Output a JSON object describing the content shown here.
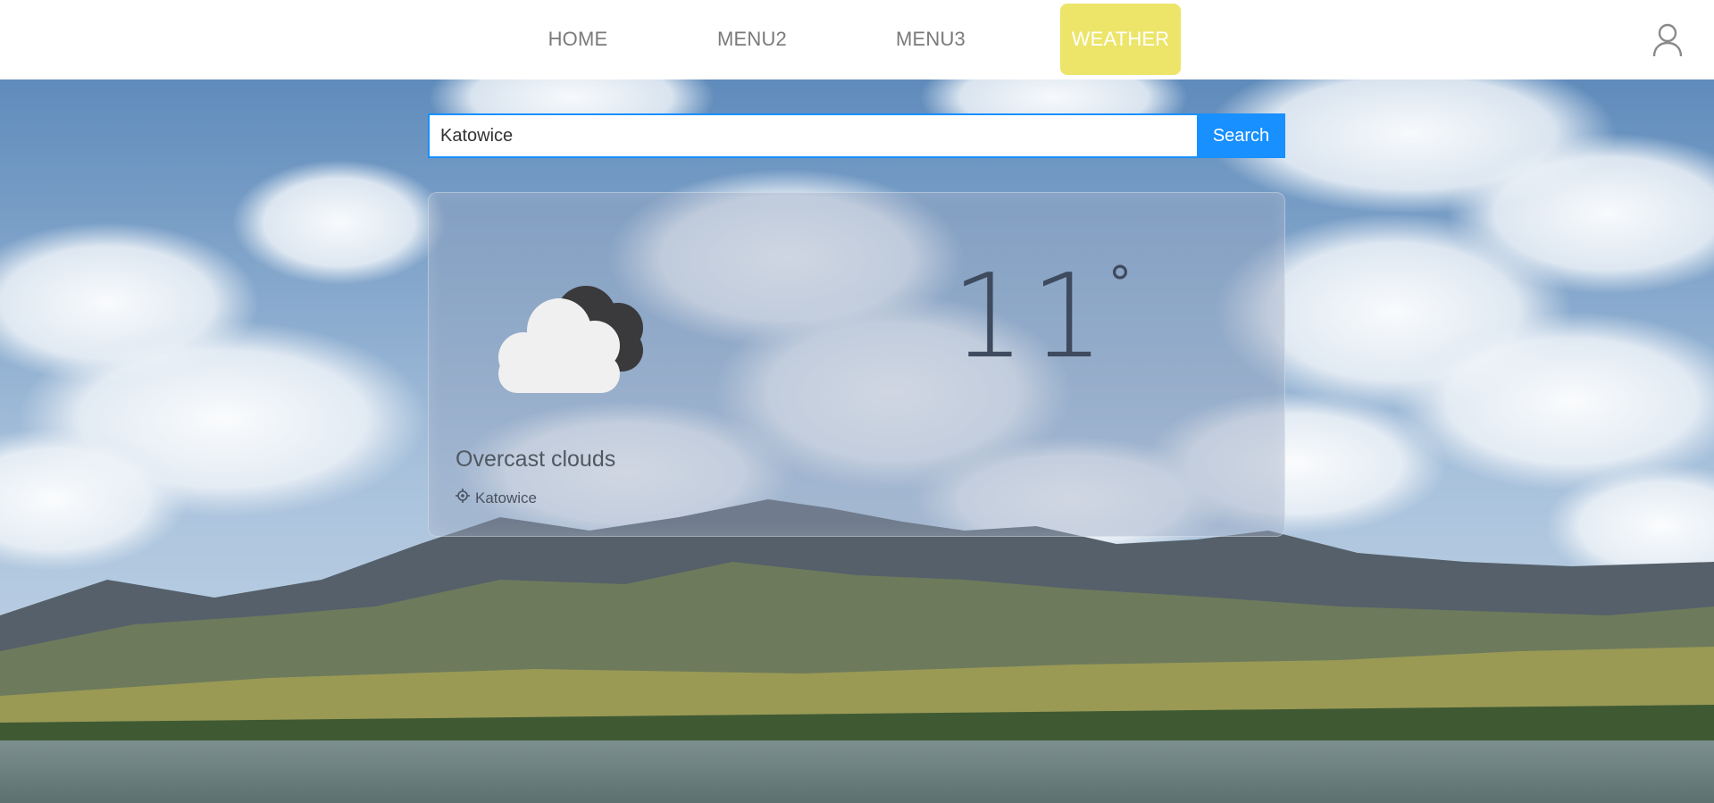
{
  "nav": {
    "items": [
      {
        "label": "HOME"
      },
      {
        "label": "MENU2"
      },
      {
        "label": "MENU3"
      },
      {
        "label": "WEATHER"
      }
    ],
    "active": "WEATHER",
    "active_color": "#ece56a",
    "user_icon": "user-icon"
  },
  "search": {
    "value": "Katowice",
    "button_label": "Search",
    "accent_color": "#1890ff"
  },
  "weather": {
    "temperature": "11",
    "degree_symbol": "°",
    "description": "Overcast clouds",
    "location": "Katowice",
    "condition_icon": "overcast-clouds-icon",
    "location_icon": "location-crosshair-icon"
  }
}
